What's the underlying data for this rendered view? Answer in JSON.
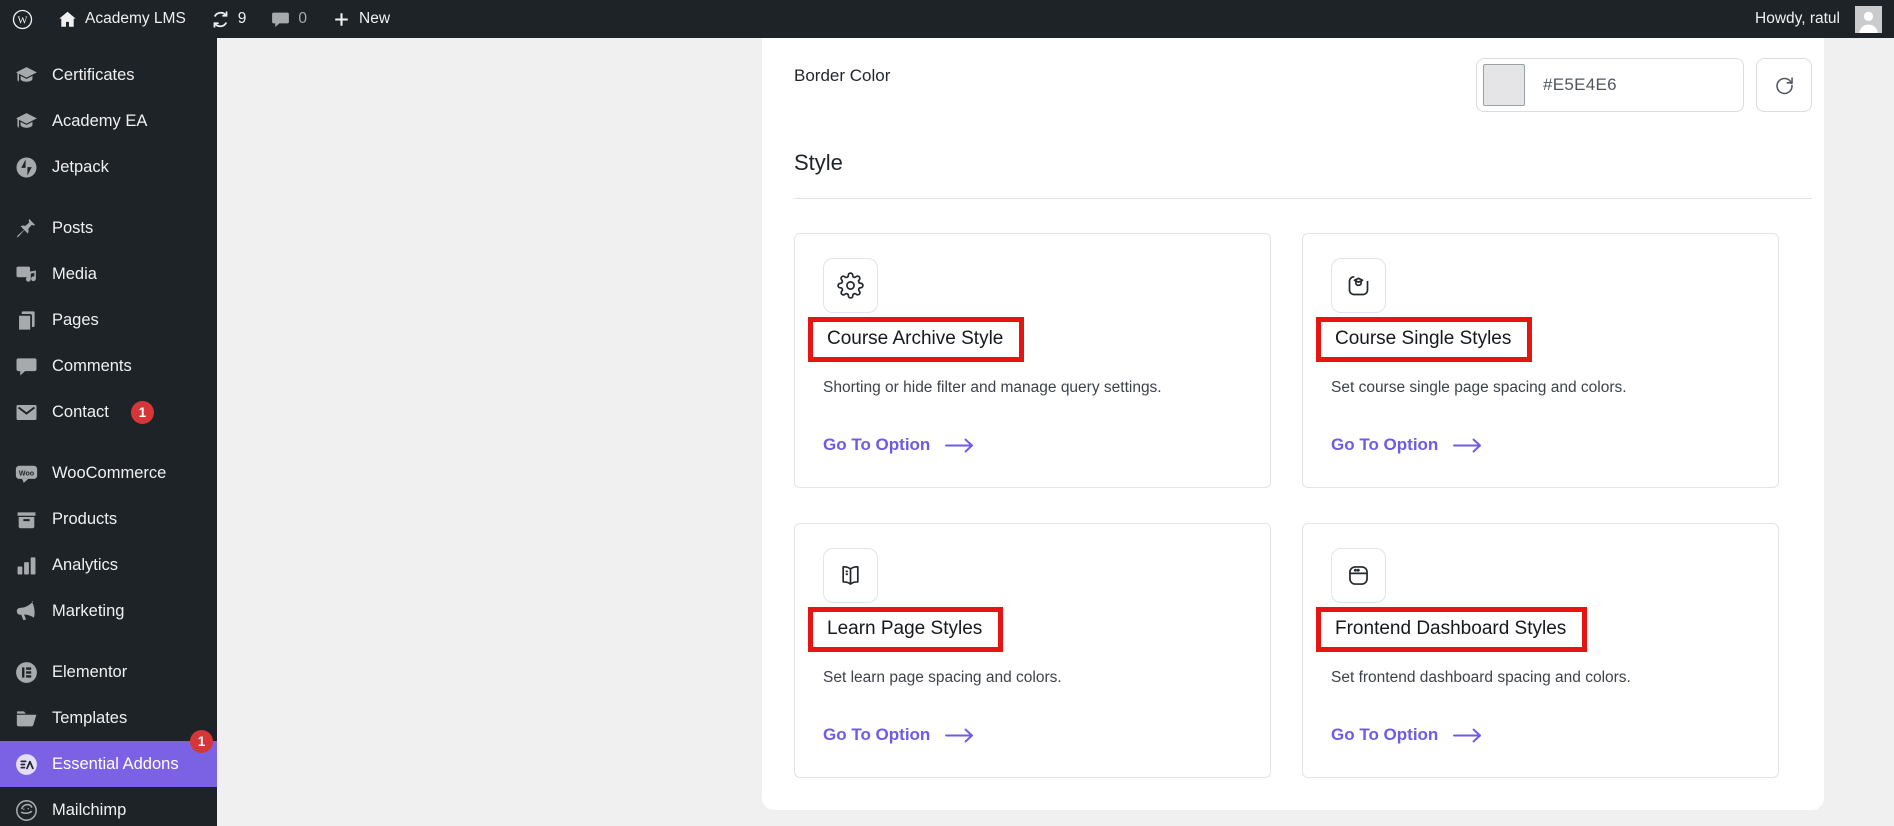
{
  "admin_bar": {
    "site_name": "Academy LMS",
    "updates_count": "9",
    "comments_count": "0",
    "new_label": "New",
    "howdy_text": "Howdy, ratul"
  },
  "sidebar": {
    "groups": [
      {
        "items": [
          {
            "label": "Certificates",
            "icon": "graduation-cap"
          },
          {
            "label": "Academy EA",
            "icon": "graduation-cap"
          },
          {
            "label": "Jetpack",
            "icon": "jetpack"
          }
        ]
      },
      {
        "items": [
          {
            "label": "Posts",
            "icon": "pin"
          },
          {
            "label": "Media",
            "icon": "media"
          },
          {
            "label": "Pages",
            "icon": "pages"
          },
          {
            "label": "Comments",
            "icon": "comment"
          },
          {
            "label": "Contact",
            "icon": "envelope",
            "badge": "1"
          }
        ]
      },
      {
        "items": [
          {
            "label": "WooCommerce",
            "icon": "woo"
          },
          {
            "label": "Products",
            "icon": "box"
          },
          {
            "label": "Analytics",
            "icon": "chart"
          },
          {
            "label": "Marketing",
            "icon": "megaphone"
          }
        ]
      },
      {
        "items": [
          {
            "label": "Elementor",
            "icon": "elementor"
          },
          {
            "label": "Templates",
            "icon": "folder"
          },
          {
            "label": "Essential Addons",
            "icon": "ea",
            "badge": "1",
            "active": true
          },
          {
            "label": "Mailchimp",
            "icon": "mailchimp"
          }
        ]
      }
    ]
  },
  "page": {
    "border_color_label": "Border Color",
    "border_color_value": "#E5E4E6",
    "section_title": "Style",
    "cards": [
      {
        "icon": "gear",
        "title": "Course Archive Style",
        "description": "Shorting or hide filter and manage query settings.",
        "link_label": "Go To Option"
      },
      {
        "icon": "course-single",
        "title": "Course Single Styles",
        "description": "Set course single page spacing and colors.",
        "link_label": "Go To Option"
      },
      {
        "icon": "book",
        "title": "Learn Page Styles",
        "description": "Set learn page spacing and colors.",
        "link_label": "Go To Option"
      },
      {
        "icon": "dashboard",
        "title": "Frontend Dashboard Styles",
        "description": "Set frontend dashboard spacing and colors.",
        "link_label": "Go To Option"
      }
    ]
  },
  "colors": {
    "annotation_red": "#E81313",
    "link_purple": "#6C5CE7",
    "active_menu_purple": "#7B61E4",
    "badge_red": "#D63638",
    "swatch": "#E5E4E6"
  }
}
